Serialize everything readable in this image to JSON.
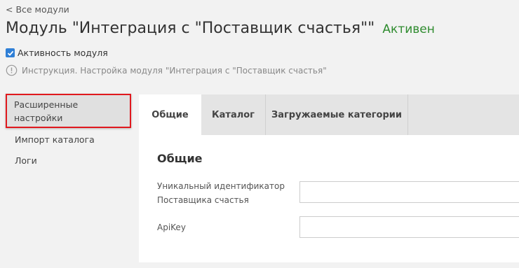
{
  "nav": {
    "back_label": "< Все модули"
  },
  "header": {
    "title": "Модуль \"Интеграция с \"Поставщик счастья\"\"",
    "status": "Активен",
    "status_color": "#2e8b2e"
  },
  "activity": {
    "label": "Активность модуля",
    "checked": true
  },
  "instruction": {
    "text": "Инструкция. Настройка модуля \"Интеграция с \"Поставщик счастья\""
  },
  "sidebar": {
    "items": [
      {
        "label": "Расширенные настройки",
        "line1": "Расширенные",
        "line2": "настройки",
        "active": true
      },
      {
        "label": "Импорт каталога",
        "active": false
      },
      {
        "label": "Логи",
        "active": false
      }
    ]
  },
  "tabs": [
    {
      "label": "Общие",
      "active": true
    },
    {
      "label": "Каталог",
      "active": false
    },
    {
      "label": "Загружаемые категории",
      "active": false
    }
  ],
  "form": {
    "section_title": "Общие",
    "fields": [
      {
        "label_line1": "Уникальный идентификатор",
        "label_line2": "Поставщика счастья",
        "value": ""
      },
      {
        "label": "ApiKey",
        "value": ""
      }
    ]
  },
  "colors": {
    "highlight_border": "#e0191e",
    "checkbox": "#2f7fd6"
  }
}
